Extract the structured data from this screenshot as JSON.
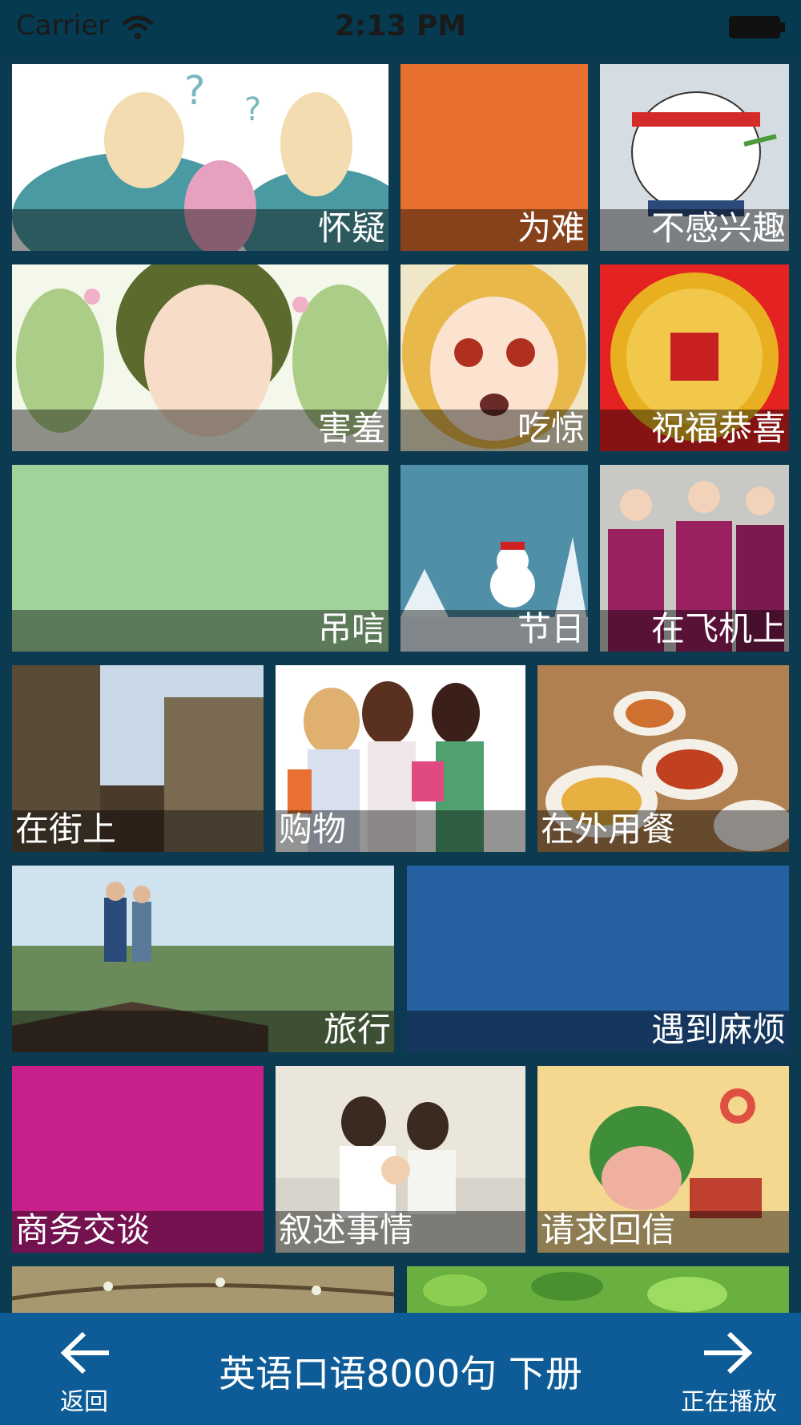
{
  "status_bar": {
    "carrier": "Carrier",
    "time": "2:13 PM"
  },
  "tiles": {
    "t1": "怀疑",
    "t2": "为难",
    "t3": "不感兴趣",
    "t4": "害羞",
    "t5": "吃惊",
    "t6": "祝福恭喜",
    "t7": "吊唁",
    "t8": "节日",
    "t9": "在飞机上",
    "t10": "在街上",
    "t11": "购物",
    "t12": "在外用餐",
    "t13": "旅行",
    "t14": "遇到麻烦",
    "t15": "商务交谈",
    "t16": "叙述事情",
    "t17": "请求回信"
  },
  "nav": {
    "title": "英语口语8000句 下册",
    "back_label": "返回",
    "play_label": "正在播放"
  },
  "colors": {
    "background": "#0c3a50",
    "nav_bar": "#0e5c97",
    "orange": "#e8702f",
    "green": "#9fd39a",
    "blue": "#2560a0",
    "magenta": "#c8208a"
  }
}
